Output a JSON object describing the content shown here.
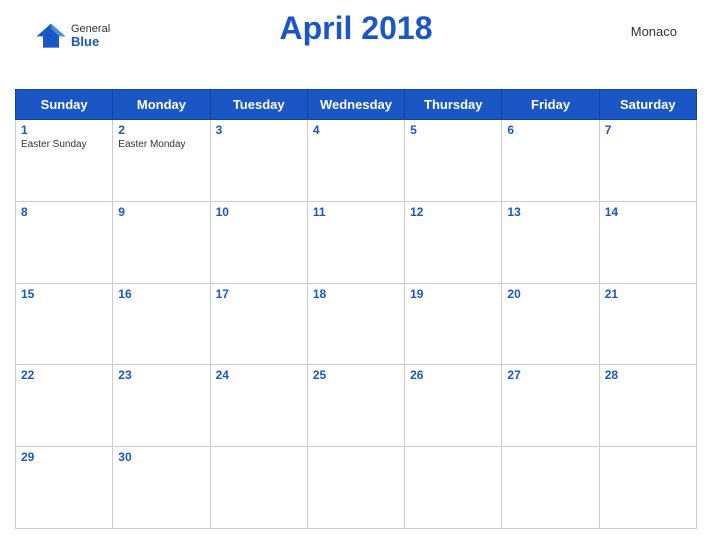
{
  "header": {
    "title": "April 2018",
    "country": "Monaco",
    "logo": {
      "general": "General",
      "blue": "Blue"
    }
  },
  "days_of_week": [
    "Sunday",
    "Monday",
    "Tuesday",
    "Wednesday",
    "Thursday",
    "Friday",
    "Saturday"
  ],
  "weeks": [
    [
      {
        "date": "1",
        "holiday": "Easter Sunday"
      },
      {
        "date": "2",
        "holiday": "Easter Monday"
      },
      {
        "date": "3",
        "holiday": ""
      },
      {
        "date": "4",
        "holiday": ""
      },
      {
        "date": "5",
        "holiday": ""
      },
      {
        "date": "6",
        "holiday": ""
      },
      {
        "date": "7",
        "holiday": ""
      }
    ],
    [
      {
        "date": "8",
        "holiday": ""
      },
      {
        "date": "9",
        "holiday": ""
      },
      {
        "date": "10",
        "holiday": ""
      },
      {
        "date": "11",
        "holiday": ""
      },
      {
        "date": "12",
        "holiday": ""
      },
      {
        "date": "13",
        "holiday": ""
      },
      {
        "date": "14",
        "holiday": ""
      }
    ],
    [
      {
        "date": "15",
        "holiday": ""
      },
      {
        "date": "16",
        "holiday": ""
      },
      {
        "date": "17",
        "holiday": ""
      },
      {
        "date": "18",
        "holiday": ""
      },
      {
        "date": "19",
        "holiday": ""
      },
      {
        "date": "20",
        "holiday": ""
      },
      {
        "date": "21",
        "holiday": ""
      }
    ],
    [
      {
        "date": "22",
        "holiday": ""
      },
      {
        "date": "23",
        "holiday": ""
      },
      {
        "date": "24",
        "holiday": ""
      },
      {
        "date": "25",
        "holiday": ""
      },
      {
        "date": "26",
        "holiday": ""
      },
      {
        "date": "27",
        "holiday": ""
      },
      {
        "date": "28",
        "holiday": ""
      }
    ],
    [
      {
        "date": "29",
        "holiday": ""
      },
      {
        "date": "30",
        "holiday": ""
      },
      {
        "date": "",
        "holiday": ""
      },
      {
        "date": "",
        "holiday": ""
      },
      {
        "date": "",
        "holiday": ""
      },
      {
        "date": "",
        "holiday": ""
      },
      {
        "date": "",
        "holiday": ""
      }
    ]
  ]
}
